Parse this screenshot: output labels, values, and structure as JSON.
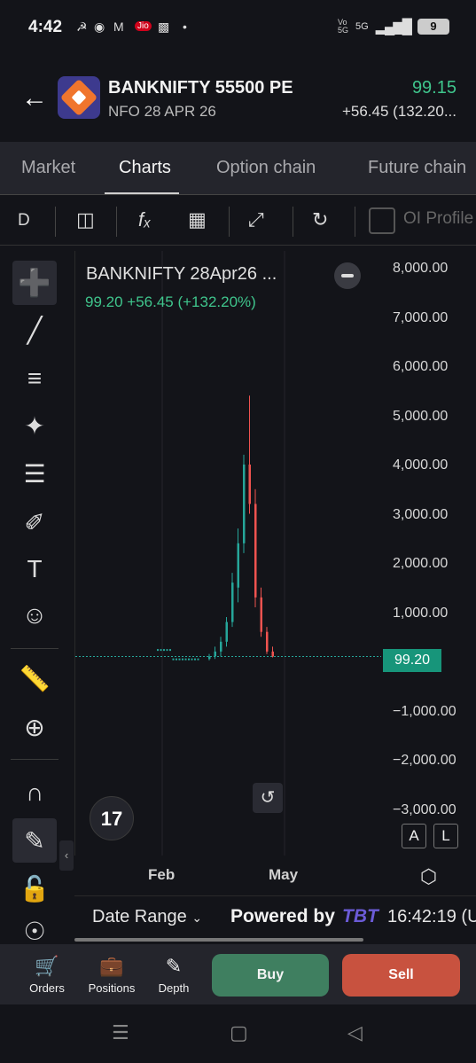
{
  "status": {
    "time": "4:42",
    "icons": [
      "person-icon",
      "facebook-icon",
      "mail-icon",
      "jio-icon",
      "app-icon",
      "dot-icon"
    ],
    "network": "5G",
    "battery": "9"
  },
  "header": {
    "symbol": "BANKNIFTY 55500 PE",
    "subtitle": "NFO 28 APR 26",
    "ltp": "99.15",
    "change": "+56.45 (132.20...",
    "ltp_color": "#3fc58c"
  },
  "tabs": [
    "Market",
    "Charts",
    "Option chain",
    "Future chain"
  ],
  "toolbar": {
    "interval": "D",
    "oi_label": "OI Profile"
  },
  "chart": {
    "title": "BANKNIFTY 28Apr26 ...",
    "sub": "99.20  +56.45 (+132.20%)",
    "y_ticks": [
      "8,000.00",
      "7,000.00",
      "6,000.00",
      "5,000.00",
      "4,000.00",
      "3,000.00",
      "2,000.00",
      "1,000.00",
      "−1,000.00",
      "−2,000.00",
      "−3,000.00"
    ],
    "price_tag": "99.20",
    "x_ticks": [
      "Feb",
      "May"
    ],
    "auto_btn": "A",
    "log_btn": "L",
    "up_color": "#26a69a",
    "down_color": "#ef5350"
  },
  "chart_data": {
    "type": "candlestick",
    "ylim": [
      -3000,
      8000
    ],
    "x_ticks": [
      "Feb",
      "May"
    ],
    "last_price": 99.2,
    "approx_ohlc_sequence": [
      {
        "o": 50,
        "h": 150,
        "l": 20,
        "c": 100
      },
      {
        "o": 100,
        "h": 300,
        "l": 50,
        "c": 200
      },
      {
        "o": 200,
        "h": 500,
        "l": 100,
        "c": 400
      },
      {
        "o": 400,
        "h": 900,
        "l": 300,
        "c": 800
      },
      {
        "o": 800,
        "h": 1800,
        "l": 700,
        "c": 1600
      },
      {
        "o": 1500,
        "h": 2700,
        "l": 1200,
        "c": 2400
      },
      {
        "o": 2400,
        "h": 4200,
        "l": 2200,
        "c": 4000
      },
      {
        "o": 4000,
        "h": 5400,
        "l": 3000,
        "c": 3200
      },
      {
        "o": 3200,
        "h": 3500,
        "l": 1100,
        "c": 1300
      },
      {
        "o": 1300,
        "h": 1500,
        "l": 500,
        "c": 600
      },
      {
        "o": 600,
        "h": 700,
        "l": 150,
        "c": 200
      },
      {
        "o": 200,
        "h": 300,
        "l": 80,
        "c": 99.2
      }
    ]
  },
  "range_bar": {
    "date_range": "Date Range",
    "powered_by": "Powered by",
    "brand": "TBT",
    "clock": "16:42:19 (U"
  },
  "actions": {
    "orders": "Orders",
    "positions": "Positions",
    "depth": "Depth",
    "buy": "Buy",
    "sell": "Sell"
  }
}
